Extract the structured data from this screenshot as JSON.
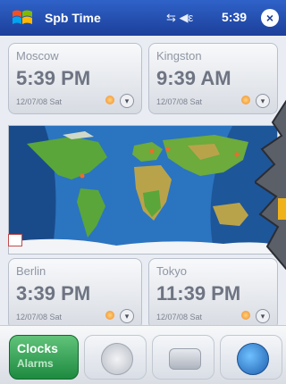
{
  "app": {
    "title": "Spb Time"
  },
  "statusbar": {
    "time": "5:39",
    "icons": "⇆ ◀ε"
  },
  "close_glyph": "×",
  "clocks": [
    {
      "city": "Moscow",
      "time": "5:39 PM",
      "date": "12/07/08 Sat"
    },
    {
      "city": "Kingston",
      "time": "9:39 AM",
      "date": "12/07/08 Sat"
    },
    {
      "city": "Berlin",
      "time": "3:39 PM",
      "date": "12/07/08 Sat"
    },
    {
      "city": "Tokyo",
      "time": "11:39 PM",
      "date": "12/07/08 Sat"
    }
  ],
  "expand_glyph": "▾",
  "bottom": {
    "clocks_label": "Clocks",
    "alarms_label": "Alarms"
  },
  "colors": {
    "titlebar": "#1c3f9a",
    "ocean": "#2b74c0",
    "land": "#5aa63a",
    "clocks_button": "#1d8a40"
  }
}
